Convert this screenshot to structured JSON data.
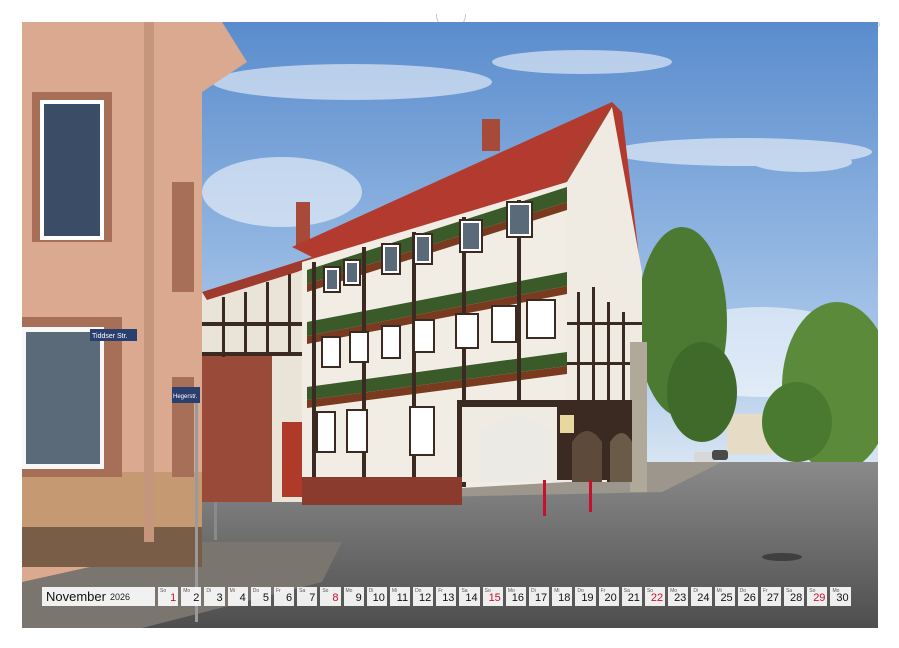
{
  "calendar": {
    "month": "November",
    "year": "2026",
    "days": [
      {
        "day": "1",
        "weekday": "So",
        "red": true
      },
      {
        "day": "2",
        "weekday": "Mo",
        "red": false
      },
      {
        "day": "3",
        "weekday": "Di",
        "red": false
      },
      {
        "day": "4",
        "weekday": "Mi",
        "red": false
      },
      {
        "day": "5",
        "weekday": "Do",
        "red": false
      },
      {
        "day": "6",
        "weekday": "Fr",
        "red": false
      },
      {
        "day": "7",
        "weekday": "Sa",
        "red": false
      },
      {
        "day": "8",
        "weekday": "So",
        "red": true
      },
      {
        "day": "9",
        "weekday": "Mo",
        "red": false
      },
      {
        "day": "10",
        "weekday": "Di",
        "red": false
      },
      {
        "day": "11",
        "weekday": "Mi",
        "red": false
      },
      {
        "day": "12",
        "weekday": "Do",
        "red": false
      },
      {
        "day": "13",
        "weekday": "Fr",
        "red": false
      },
      {
        "day": "14",
        "weekday": "Sa",
        "red": false
      },
      {
        "day": "15",
        "weekday": "So",
        "red": true
      },
      {
        "day": "16",
        "weekday": "Mo",
        "red": false
      },
      {
        "day": "17",
        "weekday": "Di",
        "red": false
      },
      {
        "day": "18",
        "weekday": "Mi",
        "red": false
      },
      {
        "day": "19",
        "weekday": "Do",
        "red": false
      },
      {
        "day": "20",
        "weekday": "Fr",
        "red": false
      },
      {
        "day": "21",
        "weekday": "Sa",
        "red": false
      },
      {
        "day": "22",
        "weekday": "So",
        "red": true
      },
      {
        "day": "23",
        "weekday": "Mo",
        "red": false
      },
      {
        "day": "24",
        "weekday": "Di",
        "red": false
      },
      {
        "day": "25",
        "weekday": "Mi",
        "red": false
      },
      {
        "day": "26",
        "weekday": "Do",
        "red": false
      },
      {
        "day": "27",
        "weekday": "Fr",
        "red": false
      },
      {
        "day": "28",
        "weekday": "Sa",
        "red": false
      },
      {
        "day": "29",
        "weekday": "So",
        "red": true
      },
      {
        "day": "30",
        "weekday": "Mo",
        "red": false
      }
    ]
  },
  "photo": {
    "street_sign_1": "Tiddser Str.",
    "street_sign_2": "Hegerstr."
  },
  "colors": {
    "sky_top": "#5c8fcf",
    "sky_bottom": "#cfe0f2",
    "roof": "#b23a2e",
    "beam": "#3a2a22",
    "plaster": "#f2ede4",
    "brick": "#8b3b2e",
    "road": "#6e6e6e",
    "red_day": "#c8102e"
  }
}
